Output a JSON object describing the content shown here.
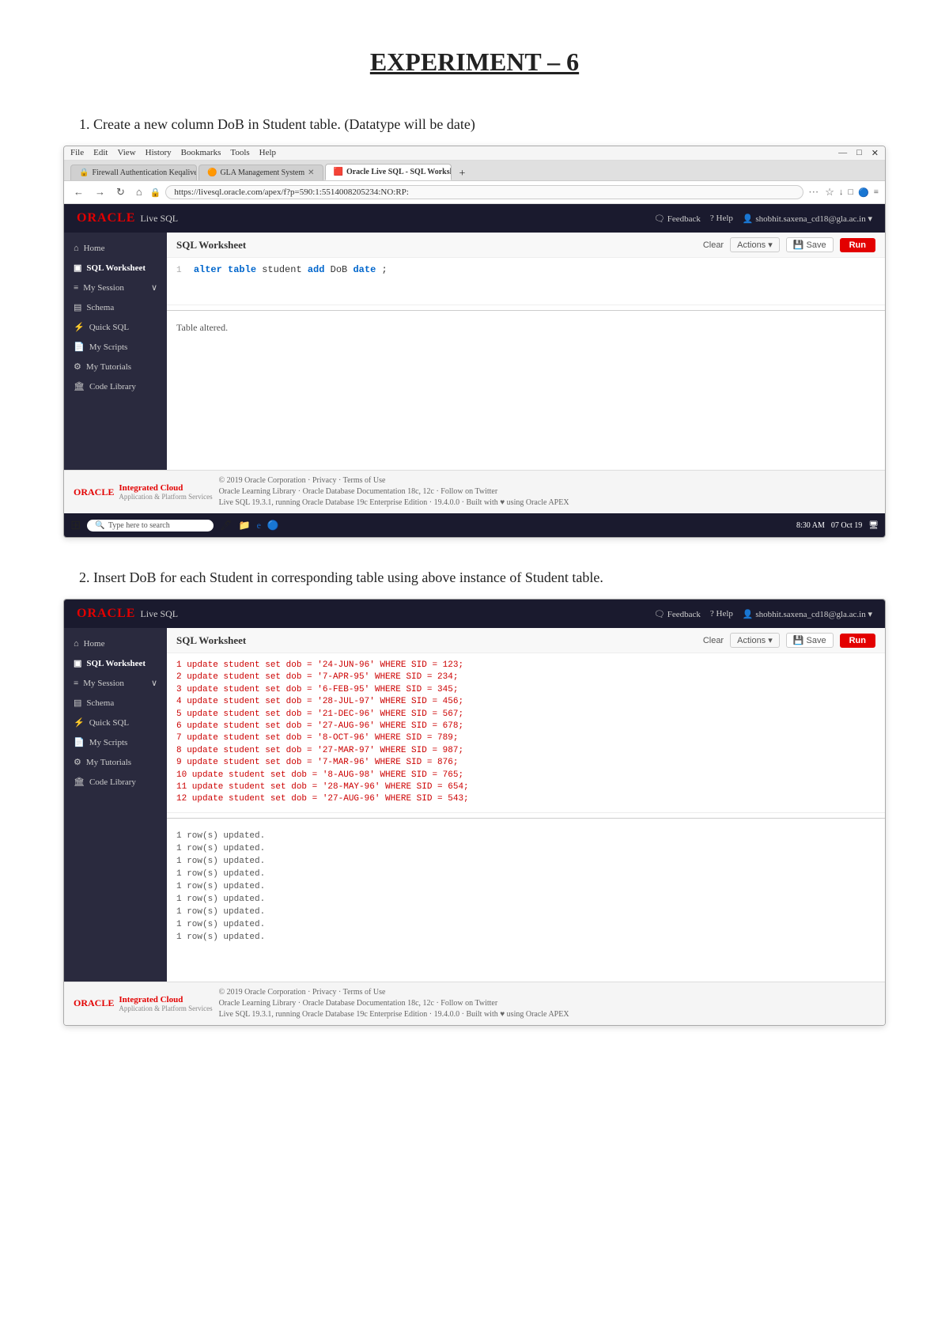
{
  "page": {
    "title": "EXPERIMENT – 6"
  },
  "section1": {
    "header": "1.  Create a new column DoB in Student table. (Datatype will be date)",
    "browser": {
      "menubar": [
        "File",
        "Edit",
        "View",
        "History",
        "Bookmarks",
        "Tools",
        "Help"
      ],
      "tabs": [
        {
          "label": "Firewall Authentication Keqalive",
          "active": false,
          "icon": "🔒"
        },
        {
          "label": "GLA Management System",
          "active": false,
          "icon": "🟠"
        },
        {
          "label": "Oracle Live SQL - SQL Worksh...",
          "active": true,
          "icon": "🟥"
        }
      ],
      "address": "https://livesql.oracle.com/apex/f?p=590:1:5514008205234:NO:RP:",
      "oracle_header": {
        "logo": "ORACLE",
        "product": "Live SQL",
        "feedback": "Feedback",
        "help": "Help",
        "user": "shobhit.saxena_cd18@gla.ac.in"
      },
      "sidebar": {
        "items": [
          {
            "label": "Home",
            "icon": "⌂",
            "active": false
          },
          {
            "label": "SQL Worksheet",
            "icon": "▣",
            "active": true
          },
          {
            "label": "My Session",
            "icon": "≡",
            "active": false
          },
          {
            "label": "Schema",
            "icon": "▤",
            "active": false
          },
          {
            "label": "Quick SQL",
            "icon": "⚡",
            "active": false
          },
          {
            "label": "My Scripts",
            "icon": "📄",
            "active": false
          },
          {
            "label": "My Tutorials",
            "icon": "⚙",
            "active": false
          },
          {
            "label": "Code Library",
            "icon": "🏛",
            "active": false
          }
        ]
      },
      "sql_worksheet": {
        "title": "SQL Worksheet",
        "code": "1  alter table student add DoB date;",
        "result": "Table altered.",
        "toolbar": {
          "clear": "Clear",
          "actions": "Actions ▾",
          "save": "Save",
          "run": "Run"
        }
      },
      "footer": {
        "oracle_label": "ORACLE",
        "cloud_label": "Integrated Cloud",
        "cloud_sub": "Application & Platform Services",
        "text_line1": "© 2019 Oracle Corporation · Privacy · Terms of Use",
        "text_line2": "Oracle Learning Library · Oracle Database Documentation 18c, 12c · Follow on Twitter",
        "text_line3": "Live SQL 19.3.1, running Oracle Database 19c Enterprise Edition · 19.4.0.0 ·  Built with ♥ using Oracle APEX"
      },
      "taskbar": {
        "start_icon": "⊞",
        "search_placeholder": "Type here to search",
        "time": "8:30 AM",
        "date": "07 Oct 19"
      }
    }
  },
  "section2": {
    "header": "2.  Insert DoB for each Student in corresponding table using above instance of Student table.",
    "browser": {
      "oracle_header": {
        "logo": "ORACLE",
        "product": "Live SQL",
        "feedback": "Feedback",
        "help": "Help",
        "user": "shobhit.saxena_cd18@gla.ac.in"
      },
      "sidebar": {
        "items": [
          {
            "label": "Home",
            "icon": "⌂"
          },
          {
            "label": "SQL Worksheet",
            "icon": "▣"
          },
          {
            "label": "My Session",
            "icon": "≡"
          },
          {
            "label": "Schema",
            "icon": "▤"
          },
          {
            "label": "Quick SQL",
            "icon": "⚡"
          },
          {
            "label": "My Scripts",
            "icon": "📄"
          },
          {
            "label": "My Tutorials",
            "icon": "⚙"
          },
          {
            "label": "Code Library",
            "icon": "🏛"
          }
        ]
      },
      "sql_worksheet": {
        "title": "SQL Worksheet",
        "code_lines": [
          "1   update student set dob = '24-JUN-96' WHERE SID = 123;",
          "2   update student set dob = '7-APR-95' WHERE SID = 234;",
          "3   update student set dob = '6-FEB-95' WHERE SID = 345;",
          "4   update student set dob = '28-JUL-97' WHERE SID = 456;",
          "5   update student set dob = '21-DEC-96' WHERE SID = 567;",
          "6   update student set dob = '27-AUG-96' WHERE SID = 678;",
          "7   update student set dob = '8-OCT-96' WHERE SID = 789;",
          "8   update student set dob = '27-MAR-97' WHERE SID = 987;",
          "9   update student set dob = '7-MAR-96' WHERE SID = 876;",
          "10  update student set dob = '8-AUG-98' WHERE SID = 765;",
          "11  update student set dob = '28-MAY-96' WHERE SID = 654;",
          "12  update student set dob = '27-AUG-96' WHERE SID = 543;"
        ],
        "results": [
          "1 row(s) updated.",
          "1 row(s) updated.",
          "1 row(s) updated.",
          "1 row(s) updated.",
          "1 row(s) updated.",
          "1 row(s) updated.",
          "1 row(s) updated.",
          "1 row(s) updated.",
          "1 row(s) updated."
        ],
        "toolbar": {
          "clear": "Clear",
          "actions": "Actions ▾",
          "save": "Save",
          "run": "Run"
        }
      },
      "footer": {
        "oracle_label": "ORACLE",
        "cloud_label": "Integrated Cloud",
        "cloud_sub": "Application & Platform Services",
        "text_line1": "© 2019 Oracle Corporation · Privacy · Terms of Use",
        "text_line2": "Oracle Learning Library · Oracle Database Documentation 18c, 12c · Follow on Twitter",
        "text_line3": "Live SQL 19.3.1, running Oracle Database 19c Enterprise Edition · 19.4.0.0 ·  Built with ♥ using Oracle APEX"
      }
    }
  }
}
